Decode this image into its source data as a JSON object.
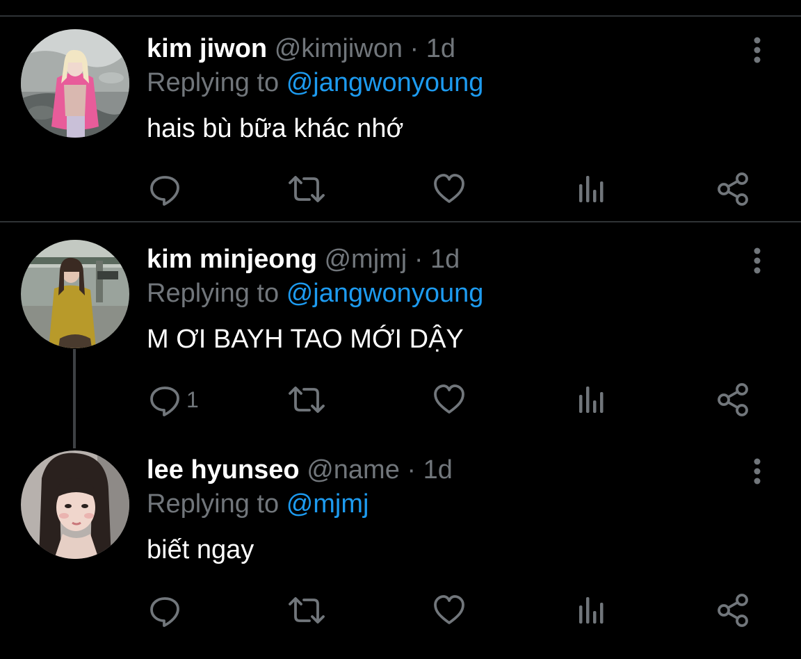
{
  "tweets": [
    {
      "name": "kim jiwon",
      "handle": "@kimjiwon",
      "separator": "·",
      "time": "1d",
      "replying_prefix": "Replying to",
      "replying_to": "@jangwonyoung",
      "text": "hais bù bữa khác nhớ",
      "reply_count": "",
      "avatar": "photo-pink-outfit"
    },
    {
      "name": "kim minjeong",
      "handle": "@mjmj",
      "separator": "·",
      "time": "1d",
      "replying_prefix": "Replying to",
      "replying_to": "@jangwonyoung",
      "text": "M ƠI BAYH TAO MỚI DẬY",
      "reply_count": "1",
      "avatar": "photo-street-yellow-top"
    },
    {
      "name": "lee hyunseo",
      "handle": "@name",
      "separator": "·",
      "time": "1d",
      "replying_prefix": "Replying to",
      "replying_to": "@mjmj",
      "text": "biết ngay",
      "reply_count": "",
      "avatar": "photo-selfie-dark-hair"
    }
  ],
  "icons": {
    "reply": "reply-icon",
    "retweet": "retweet-icon",
    "like": "heart-icon",
    "views": "analytics-icon",
    "share": "share-icon",
    "more": "more-options-icon"
  },
  "colors": {
    "background": "#000000",
    "text": "#ffffff",
    "secondary": "#71767b",
    "link": "#1d9bf0",
    "divider": "#2f3336"
  }
}
